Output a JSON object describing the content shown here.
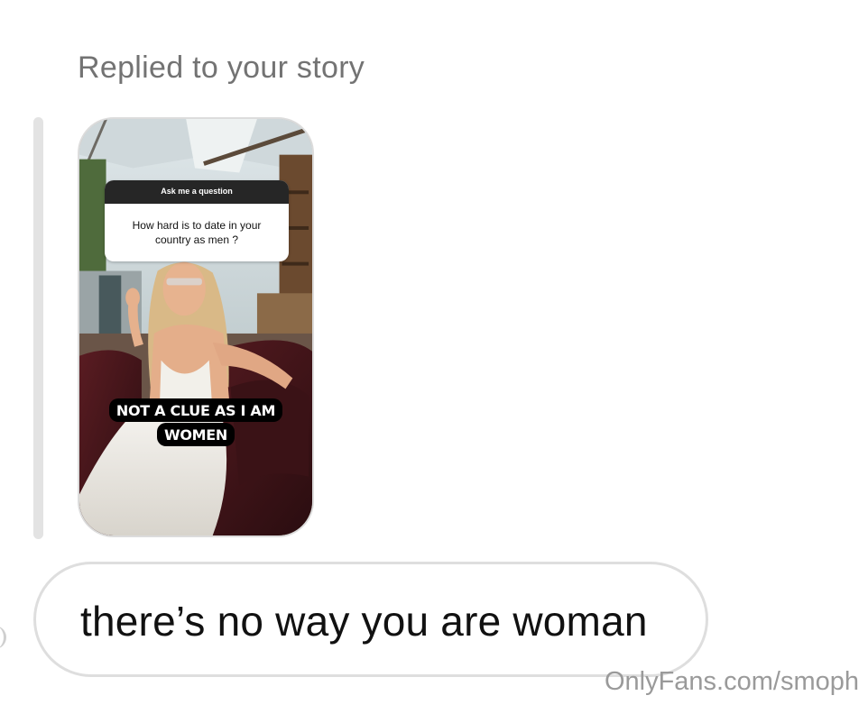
{
  "thread": {
    "reply_label": "Replied to your story"
  },
  "story": {
    "question_sticker": {
      "header": "Ask me a question",
      "question": "How hard is to date in your country as men ?"
    },
    "answer_lines": [
      "NOT A CLUE AS I AM",
      "WOMEN"
    ]
  },
  "message": {
    "text": "there’s no way you are woman"
  },
  "watermark": {
    "text": "OnlyFans.com/smoph"
  }
}
